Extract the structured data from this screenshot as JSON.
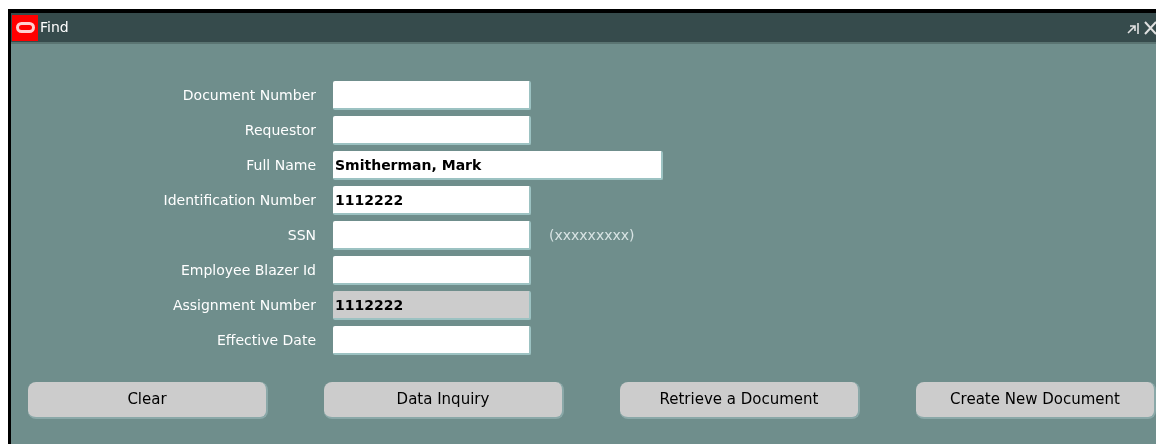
{
  "window": {
    "title": "Find"
  },
  "fields": [
    {
      "label": "Document Number",
      "disabled": false,
      "wide": false
    },
    {
      "label": "Requestor",
      "disabled": false,
      "wide": false
    },
    {
      "label": "Full Name",
      "value": "Smitherman, Mark",
      "disabled": false,
      "wide": true
    },
    {
      "label": "Identification Number",
      "value": "1112222",
      "disabled": false,
      "wide": false
    },
    {
      "label": "SSN",
      "disabled": false,
      "wide": false,
      "hint": "(xxxxxxxxx)"
    },
    {
      "label": "Employee Blazer Id",
      "disabled": false,
      "wide": false
    },
    {
      "label": "Assignment Number",
      "value": "1112222",
      "disabled": true,
      "wide": false
    },
    {
      "label": "Effective Date",
      "disabled": false,
      "wide": false
    }
  ],
  "buttons": [
    "Clear",
    "Data Inquiry",
    "Retrieve a Document",
    "Create New Document"
  ]
}
